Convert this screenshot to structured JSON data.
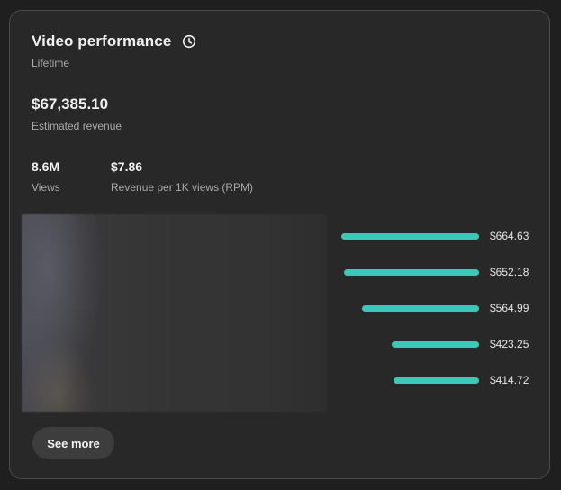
{
  "header": {
    "title": "Video performance",
    "clock_icon": "clock-icon",
    "subtitle": "Lifetime"
  },
  "revenue": {
    "value": "$67,385.10",
    "label": "Estimated revenue"
  },
  "stats": [
    {
      "value": "8.6M",
      "label": "Views"
    },
    {
      "value": "$7.86",
      "label": "Revenue per 1K views (RPM)"
    }
  ],
  "colors": {
    "bar": "#3cc8b9",
    "card_bg": "#282828",
    "page_bg": "#1f1f1f"
  },
  "chart_data": {
    "type": "bar",
    "orientation": "horizontal",
    "values": [
      664.63,
      652.18,
      564.99,
      423.25,
      414.72
    ],
    "labels": [
      "$664.63",
      "$652.18",
      "$564.99",
      "$423.25",
      "$414.72"
    ]
  },
  "actions": {
    "see_more_label": "See more"
  }
}
